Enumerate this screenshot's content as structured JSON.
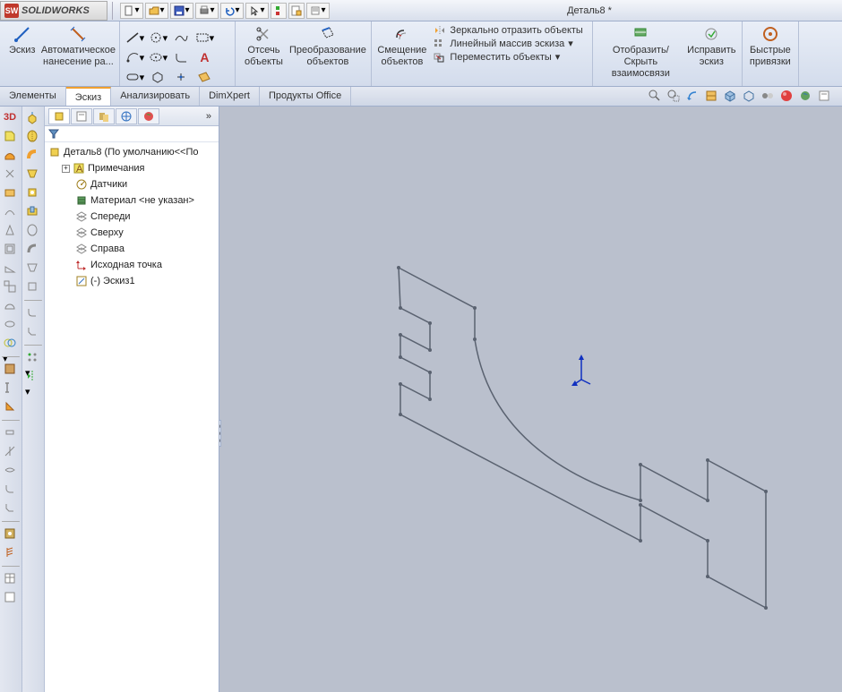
{
  "title_bar": {
    "app_name": "SOLIDWORKS",
    "document_title": "Деталь8 *"
  },
  "ribbon": {
    "sketch_btn": "Эскиз",
    "auto_dim_btn": "Автоматическое нанесение ра...",
    "trim_btn": "Отсечь объекты",
    "convert_btn": "Преобразование объектов",
    "offset_btn": "Смещение объектов",
    "mirror_btn": "Зеркально отразить объекты",
    "linear_pattern_btn": "Линейный массив эскиза",
    "move_btn": "Переместить объекты",
    "display_relations_btn": "Отобразить/Скрыть взаимосвязи",
    "repair_btn": "Исправить эскиз",
    "quick_snaps_btn": "Быстрые привязки"
  },
  "tabs": {
    "elements": "Элементы",
    "sketch": "Эскиз",
    "evaluate": "Анализировать",
    "dimxpert": "DimXpert",
    "office": "Продукты Office"
  },
  "tree": {
    "root": "Деталь8  (По умолчанию<<По",
    "annotations": "Примечания",
    "sensors": "Датчики",
    "material": "Материал <не указан>",
    "front": "Спереди",
    "top": "Сверху",
    "right": "Справа",
    "origin": "Исходная точка",
    "sketch1": "(-) Эскиз1"
  }
}
